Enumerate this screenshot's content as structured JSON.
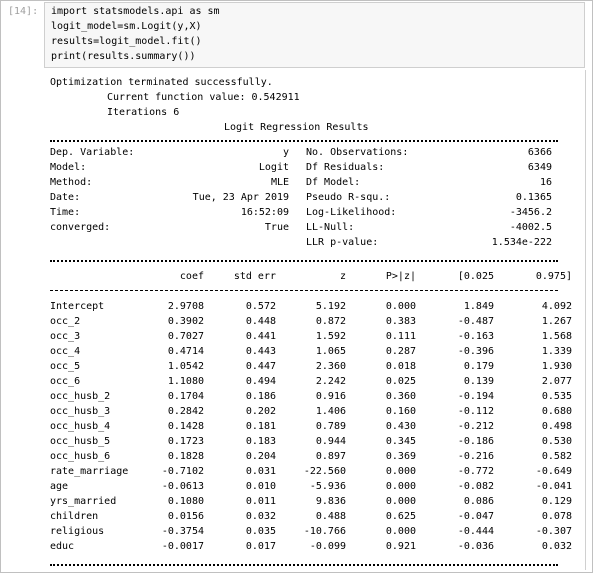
{
  "cell": {
    "prompt": "[14]:",
    "code": [
      "import statsmodels.api as sm",
      "logit_model=sm.Logit(y,X)",
      "results=logit_model.fit()",
      "print(results.summary())"
    ]
  },
  "output": {
    "opt_line1": "Optimization terminated successfully.",
    "opt_line2": "Current function value: 0.542911",
    "opt_line3": "Iterations 6",
    "title": "Logit Regression Results",
    "info_left": [
      {
        "label": "Dep. Variable:",
        "value": "y"
      },
      {
        "label": "Model:",
        "value": "Logit"
      },
      {
        "label": "Method:",
        "value": "MLE"
      },
      {
        "label": "Date:",
        "value": "Tue, 23 Apr 2019"
      },
      {
        "label": "Time:",
        "value": "16:52:09"
      },
      {
        "label": "converged:",
        "value": "True"
      }
    ],
    "info_right": [
      {
        "label": "No. Observations:",
        "value": "6366"
      },
      {
        "label": "Df Residuals:",
        "value": "6349"
      },
      {
        "label": "Df Model:",
        "value": "16"
      },
      {
        "label": "Pseudo R-squ.:",
        "value": "0.1365"
      },
      {
        "label": "Log-Likelihood:",
        "value": "-3456.2"
      },
      {
        "label": "LL-Null:",
        "value": "-4002.5"
      },
      {
        "label": "LLR p-value:",
        "value": "1.534e-222"
      }
    ],
    "columns": [
      "coef",
      "std err",
      "z",
      "P>|z|",
      "[0.025",
      "0.975]"
    ],
    "rows": [
      {
        "name": "Intercept",
        "coef": "2.9708",
        "se": "0.572",
        "z": "5.192",
        "p": "0.000",
        "lo": "1.849",
        "hi": "4.092"
      },
      {
        "name": "occ_2",
        "coef": "0.3902",
        "se": "0.448",
        "z": "0.872",
        "p": "0.383",
        "lo": "-0.487",
        "hi": "1.267"
      },
      {
        "name": "occ_3",
        "coef": "0.7027",
        "se": "0.441",
        "z": "1.592",
        "p": "0.111",
        "lo": "-0.163",
        "hi": "1.568"
      },
      {
        "name": "occ_4",
        "coef": "0.4714",
        "se": "0.443",
        "z": "1.065",
        "p": "0.287",
        "lo": "-0.396",
        "hi": "1.339"
      },
      {
        "name": "occ_5",
        "coef": "1.0542",
        "se": "0.447",
        "z": "2.360",
        "p": "0.018",
        "lo": "0.179",
        "hi": "1.930"
      },
      {
        "name": "occ_6",
        "coef": "1.1080",
        "se": "0.494",
        "z": "2.242",
        "p": "0.025",
        "lo": "0.139",
        "hi": "2.077"
      },
      {
        "name": "occ_husb_2",
        "coef": "0.1704",
        "se": "0.186",
        "z": "0.916",
        "p": "0.360",
        "lo": "-0.194",
        "hi": "0.535"
      },
      {
        "name": "occ_husb_3",
        "coef": "0.2842",
        "se": "0.202",
        "z": "1.406",
        "p": "0.160",
        "lo": "-0.112",
        "hi": "0.680"
      },
      {
        "name": "occ_husb_4",
        "coef": "0.1428",
        "se": "0.181",
        "z": "0.789",
        "p": "0.430",
        "lo": "-0.212",
        "hi": "0.498"
      },
      {
        "name": "occ_husb_5",
        "coef": "0.1723",
        "se": "0.183",
        "z": "0.944",
        "p": "0.345",
        "lo": "-0.186",
        "hi": "0.530"
      },
      {
        "name": "occ_husb_6",
        "coef": "0.1828",
        "se": "0.204",
        "z": "0.897",
        "p": "0.369",
        "lo": "-0.216",
        "hi": "0.582"
      },
      {
        "name": "rate_marriage",
        "coef": "-0.7102",
        "se": "0.031",
        "z": "-22.560",
        "p": "0.000",
        "lo": "-0.772",
        "hi": "-0.649"
      },
      {
        "name": "age",
        "coef": "-0.0613",
        "se": "0.010",
        "z": "-5.936",
        "p": "0.000",
        "lo": "-0.082",
        "hi": "-0.041"
      },
      {
        "name": "yrs_married",
        "coef": "0.1080",
        "se": "0.011",
        "z": "9.836",
        "p": "0.000",
        "lo": "0.086",
        "hi": "0.129"
      },
      {
        "name": "children",
        "coef": "0.0156",
        "se": "0.032",
        "z": "0.488",
        "p": "0.625",
        "lo": "-0.047",
        "hi": "0.078"
      },
      {
        "name": "religious",
        "coef": "-0.3754",
        "se": "0.035",
        "z": "-10.766",
        "p": "0.000",
        "lo": "-0.444",
        "hi": "-0.307"
      },
      {
        "name": "educ",
        "coef": "-0.0017",
        "se": "0.017",
        "z": "-0.099",
        "p": "0.921",
        "lo": "-0.036",
        "hi": "0.032"
      }
    ]
  }
}
